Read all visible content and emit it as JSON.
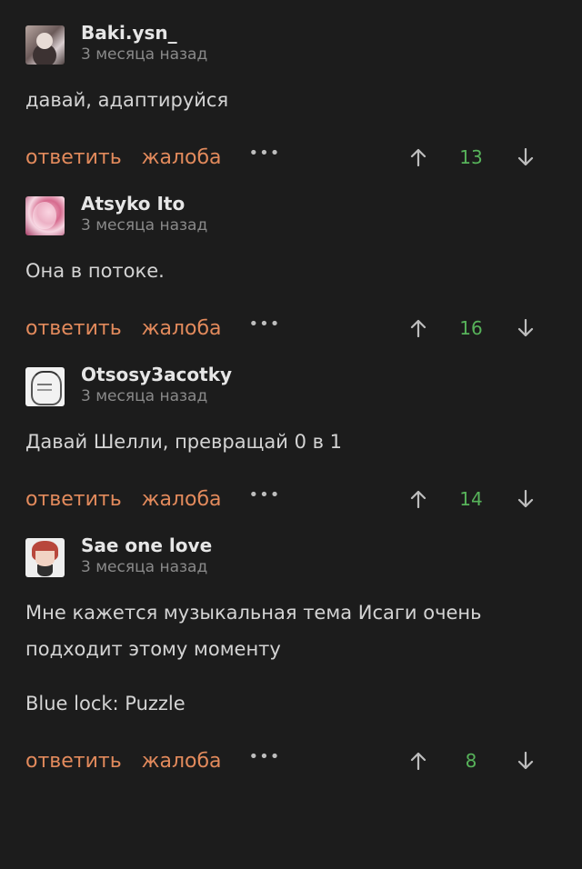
{
  "colors": {
    "background": "#1c1c1c",
    "action": "#e28a5c",
    "score": "#57b35a",
    "muted": "#8a8a8a"
  },
  "actions": {
    "reply": "ответить",
    "report": "жалоба",
    "more": "•••"
  },
  "icons": {
    "up": "arrow-up-icon",
    "down": "arrow-down-icon"
  },
  "comments": [
    {
      "author": "Baki.ysn_",
      "time": "3 месяца назад",
      "paragraphs": [
        "давай, адаптируйся"
      ],
      "score": "13"
    },
    {
      "author": "Atsyko Ito",
      "time": "3 месяца назад",
      "paragraphs": [
        "Она в потоке."
      ],
      "score": "16"
    },
    {
      "author": "Otsosy3acotky",
      "time": "3 месяца назад",
      "paragraphs": [
        "Давай Шелли, превращай 0 в 1"
      ],
      "score": "14"
    },
    {
      "author": "Sae one love",
      "time": "3 месяца назад",
      "paragraphs": [
        "Мне кажется музыкальная тема Исаги очень подходит этому моменту",
        "Blue lock: Puzzle"
      ],
      "score": "8"
    }
  ]
}
